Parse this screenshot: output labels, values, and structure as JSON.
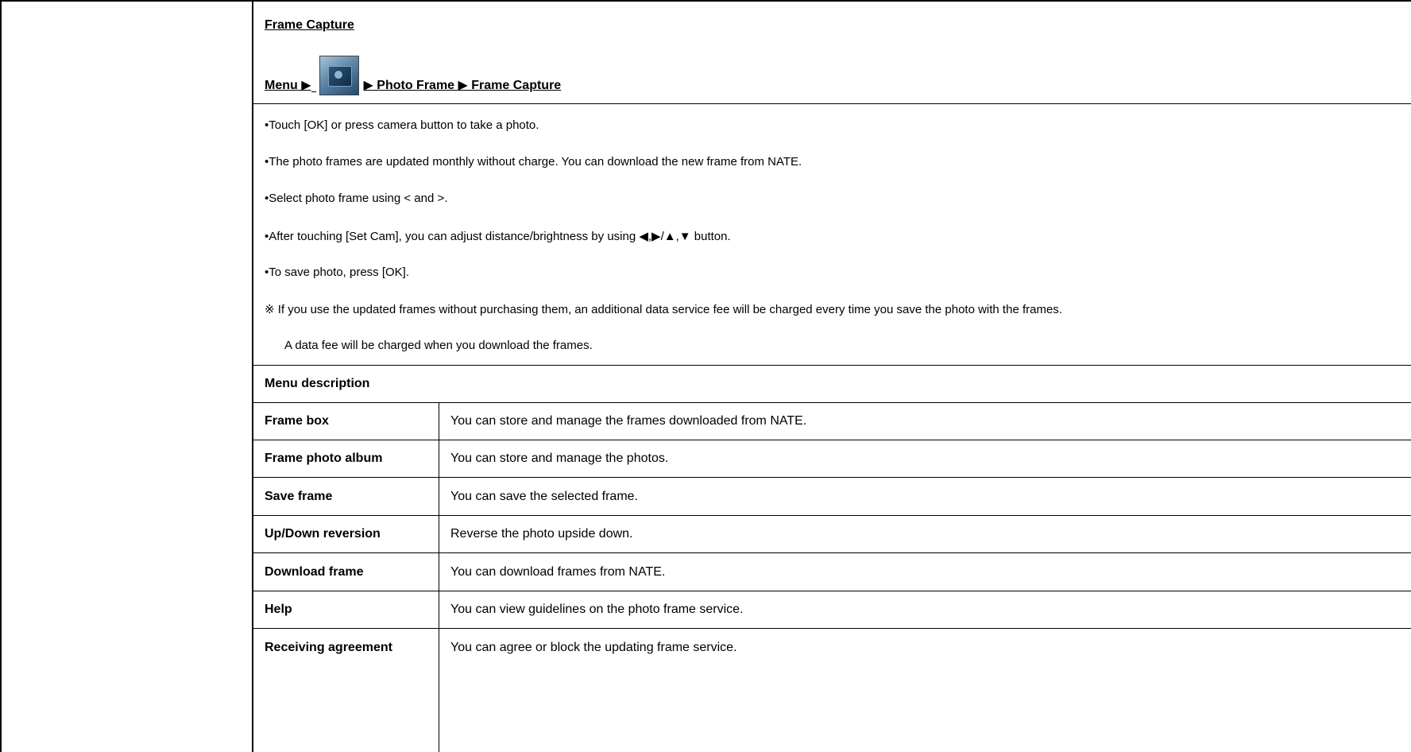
{
  "header": {
    "title": "Frame Capture",
    "menu_path": {
      "menu": "Menu ▶",
      "camera_icon": "camera-icon",
      "after_icon": "▶ Photo Frame ▶ Frame Capture"
    }
  },
  "instructions": [
    "•Touch [OK] or press camera button to take a photo.",
    "•The photo frames are updated monthly without charge. You can download the new frame from NATE.",
    "•Select photo frame using < and >.",
    "•After touching [Set Cam], you can adjust distance/brightness by using ◀,▶/▲,▼ button.",
    "•To save photo, press [OK].",
    "※ If you use the updated frames without purchasing them, an additional data service fee will be charged every time you save the photo with the frames.",
    "A data fee will be charged when you download the frames."
  ],
  "menu_description": {
    "heading": "Menu description",
    "rows": [
      {
        "label": "Frame box",
        "desc": "You can store and manage the frames downloaded from NATE."
      },
      {
        "label": "Frame photo album",
        "desc": "You can store and manage the photos."
      },
      {
        "label": "Save frame",
        "desc": "You can save the selected frame."
      },
      {
        "label": "Up/Down reversion",
        "desc": "Reverse the photo upside down."
      },
      {
        "label": "Download frame",
        "desc": "You can download frames from NATE."
      },
      {
        "label": "Help",
        "desc": "You can view guidelines on the photo frame service."
      },
      {
        "label": "Receiving agreement",
        "desc": "You can agree or block the updating frame service."
      }
    ]
  }
}
